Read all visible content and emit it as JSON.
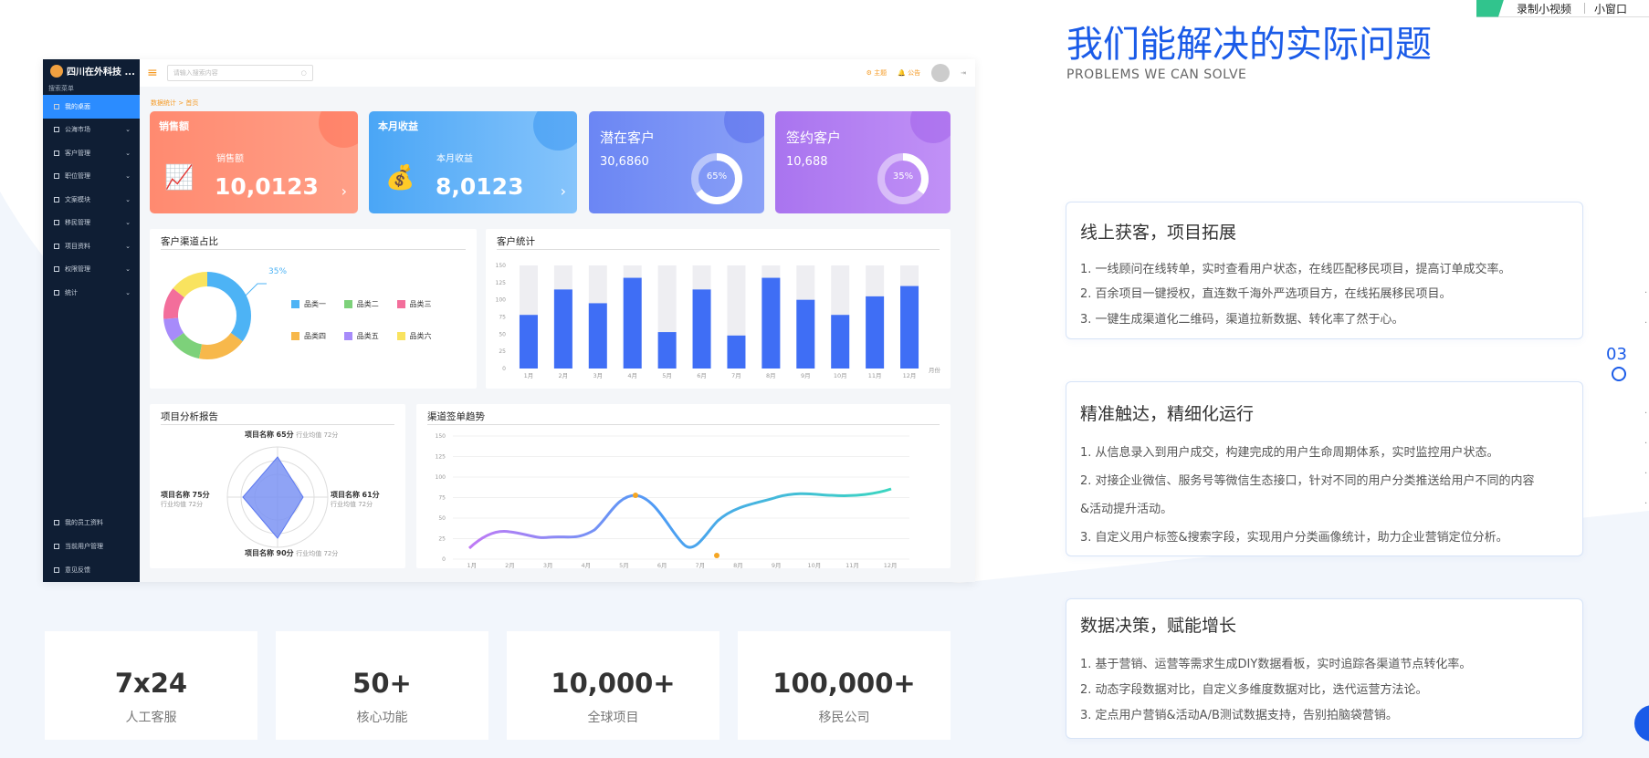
{
  "toolbar": {
    "record_label": "录制小视频",
    "mini_window_label": "小窗口"
  },
  "mock": {
    "brand": "四川在外科技 ...",
    "menu_section": "搜索菜单",
    "nav_items": [
      "我的桌面",
      "公海市场",
      "客户管理",
      "职位管理",
      "文案模块",
      "移民管理",
      "项目资料",
      "权限管理",
      "统计"
    ],
    "bottom_items": [
      "我的员工资料",
      "当前用户管理",
      "意见反馈"
    ],
    "search_placeholder": "请输入搜索内容",
    "header_links": [
      "主题",
      "公告"
    ],
    "breadcrumb": "数据统计 > 首页",
    "cards": [
      {
        "title": "销售额",
        "sub": "销售额",
        "value": "10,0123"
      },
      {
        "title": "本月收益",
        "sub": "本月收益",
        "value": "8,0123"
      },
      {
        "title": "潜在客户",
        "value": "30,6860",
        "pct": "65%"
      },
      {
        "title": "签约客户",
        "value": "10,688",
        "pct": "35%"
      }
    ],
    "donut": {
      "title": "客户渠道占比",
      "callout": "35%",
      "legend": [
        "品类一",
        "品类二",
        "品类三",
        "品类四",
        "品类五",
        "品类六"
      ],
      "legend_colors": [
        "#4db3f5",
        "#7dd17a",
        "#f36e9b",
        "#f7b84b",
        "#a78bfa",
        "#f9e35f"
      ]
    },
    "bar": {
      "title": "客户统计",
      "y_ticks": [
        "150",
        "125",
        "100",
        "75",
        "50",
        "25",
        "0"
      ],
      "months": [
        "1月",
        "2月",
        "3月",
        "4月",
        "5月",
        "6月",
        "7月",
        "8月",
        "9月",
        "10月",
        "11月",
        "12月"
      ],
      "values": [
        78,
        115,
        95,
        132,
        53,
        115,
        48,
        132,
        100,
        78,
        105,
        120
      ],
      "unit": "月份"
    },
    "radar": {
      "title": "项目分析报告",
      "labels": [
        {
          "name": "项目名称",
          "score": "65分",
          "avg": "行业均值 72分"
        },
        {
          "name": "项目名称",
          "score": "75分",
          "avg": "行业均值 72分"
        },
        {
          "name": "项目名称",
          "score": "61分",
          "avg": "行业均值 72分"
        },
        {
          "name": "项目名称",
          "score": "90分",
          "avg": "行业均值 72分"
        }
      ]
    },
    "line": {
      "title": "渠道签单趋势",
      "y_ticks": [
        "150",
        "125",
        "100",
        "75",
        "50",
        "25",
        "0"
      ],
      "months": [
        "1月",
        "2月",
        "3月",
        "4月",
        "5月",
        "6月",
        "7月",
        "8月",
        "9月",
        "10月",
        "11月",
        "12月"
      ]
    }
  },
  "right": {
    "heading": "我们能解决的实际问题",
    "subheading": "PROBLEMS WE CAN SOLVE",
    "features": [
      {
        "title": "线上获客，项目拓展",
        "lines": [
          "1. 一线顾问在线转单，实时查看用户状态，在线匹配移民项目，提高订单成交率。",
          "2. 百余项目一键授权，直连数千海外严选项目方，在线拓展移民项目。",
          "3. 一键生成渠道化二维码，渠道拉新数据、转化率了然于心。"
        ]
      },
      {
        "title": "精准触达，精细化运行",
        "lines": [
          "1. 从信息录入到用户成交，构建完成的用户生命周期体系，实时监控用户状态。",
          "2. 对接企业微信、服务号等微信生态接口，针对不同的用户分类推送给用户不同的内容",
          "&活动提升活动。",
          "3.  自定义用户标签&搜索字段，实现用户分类画像统计，助力企业营销定位分析。"
        ]
      },
      {
        "title": "数据决策，赋能增长",
        "lines": [
          "1. 基于营销、运营等需求生成DIY数据看板，实时追踪各渠道节点转化率。",
          "2. 动态字段数据对比，自定义多维度数据对比，迭代运营方法论。",
          "3. 定点用户营销&活动A/B测试数据支持，告别拍脑袋营销。"
        ]
      }
    ],
    "pager": "03"
  },
  "stats": [
    {
      "value": "7x24",
      "label": "人工客服"
    },
    {
      "value": "50+",
      "label": "核心功能"
    },
    {
      "value": "10,000+",
      "label": "全球项目"
    },
    {
      "value": "100,000+",
      "label": "移民公司"
    }
  ]
}
